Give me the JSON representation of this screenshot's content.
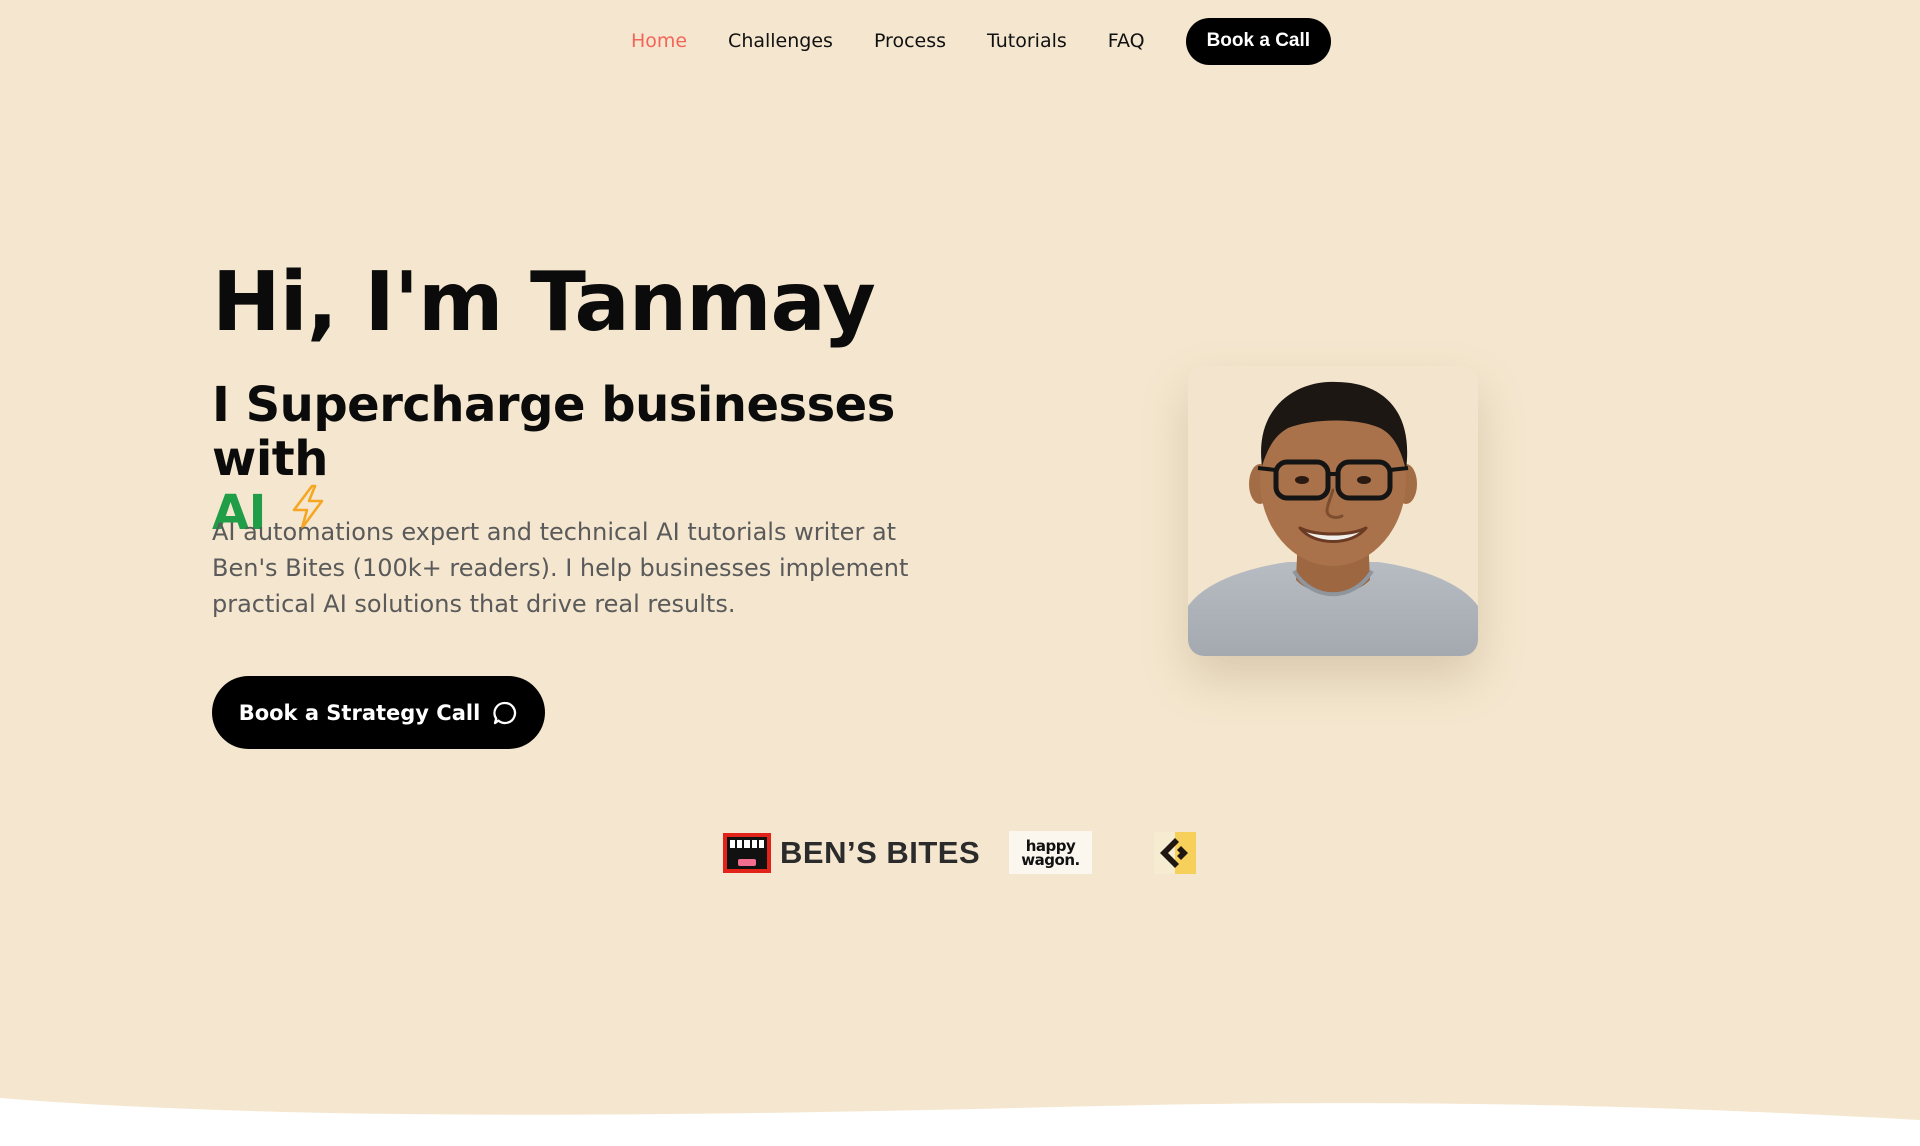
{
  "nav": {
    "items": [
      {
        "label": "Home",
        "active": true
      },
      {
        "label": "Challenges",
        "active": false
      },
      {
        "label": "Process",
        "active": false
      },
      {
        "label": "Tutorials",
        "active": false
      },
      {
        "label": "FAQ",
        "active": false
      }
    ],
    "cta_label": "Book a Call"
  },
  "hero": {
    "title": "Hi, I'm Tanmay",
    "subtitle_prefix": "I Supercharge businesses with",
    "subtitle_highlight": "AI",
    "description": "AI automations expert and technical AI tutorials writer at Ben's Bites (100k+ readers). I help businesses implement practical AI solutions that drive real results.",
    "cta_label": "Book a Strategy Call",
    "cta_icon": "chat-bubble-icon",
    "highlight_icon": "lightning-bolt-icon"
  },
  "logos": {
    "bens_bites": "BEN’S BITES",
    "happy_wagon_line1": "happy",
    "happy_wagon_line2": "wagon."
  },
  "colors": {
    "background": "#f5e7cf",
    "nav_active": "#f2665a",
    "ai_highlight": "#1f9d47",
    "bolt": "#f5a623",
    "button": "#000000",
    "description_text": "#5a5a5a"
  }
}
